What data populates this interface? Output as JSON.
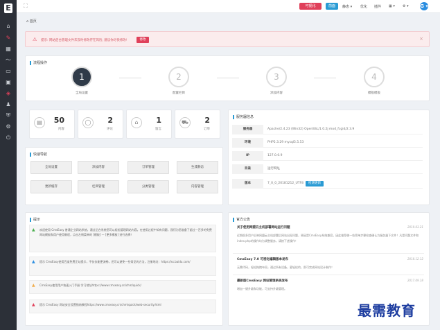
{
  "sidebar": {
    "logo": "E",
    "items": [
      "home-icon",
      "edit-icon",
      "grid-icon",
      "chart-icon",
      "monitor-icon",
      "screen-icon",
      "tag-icon",
      "user-icon",
      "shield-icon",
      "gear-icon",
      "power-icon"
    ]
  },
  "topbar": {
    "red_button": "可视化",
    "blue_button": "前面",
    "menus": [
      "静态 ▾",
      "优化",
      "插件",
      "▦ ▾",
      "⚙ ▾"
    ],
    "avatar": "G ▾"
  },
  "breadcrumb": "首页",
  "alert": {
    "text": "提示: 网站后台管理文件未及时修改存在风险, 建议你尽快修改!",
    "button": "修改",
    "close": "×"
  },
  "flow": {
    "title": "流程操作",
    "steps": [
      {
        "num": "1",
        "label": "全局设置"
      },
      {
        "num": "2",
        "label": "配置栏目"
      },
      {
        "num": "3",
        "label": "添加内容"
      },
      {
        "num": "4",
        "label": "模板模板"
      }
    ]
  },
  "stats": [
    {
      "icon": "document-icon",
      "num": "50",
      "label": "内容"
    },
    {
      "icon": "comment-icon",
      "num": "2",
      "label": "评论"
    },
    {
      "icon": "house-icon",
      "num": "1",
      "label": "留言"
    },
    {
      "icon": "cart-icon",
      "num": "2",
      "label": "订单"
    }
  ],
  "quick": {
    "title": "快速导航",
    "buttons": [
      "全局设置",
      "添加内容",
      "订单管理",
      "生成静态",
      "更新缓存",
      "栏目管理",
      "分类管理",
      "内容管理"
    ]
  },
  "server": {
    "title": "服务器信息",
    "rows": [
      {
        "k": "服务器",
        "v": "Apache/2.4.23 (Win32) OpenSSL/1.0.2j mod_fcgid/2.3.9"
      },
      {
        "k": "环境",
        "v": "PHP5.3.29 mysql5.5.53"
      },
      {
        "k": "IP",
        "v": "127.0.0.9"
      },
      {
        "k": "目录",
        "v": "运行网址"
      },
      {
        "k": "版本",
        "v": "7_0_0_20181212_UTF8",
        "btn": "检测更新"
      }
    ]
  },
  "tips": {
    "title": "提示",
    "items": [
      {
        "color": "#4caf50",
        "text": "欢迎使用 CmsEasy 普通企业网站系统，通过后台系统您可以轻松管理网站内容。在使用过程中如有问题，我们为您准备了超过一百多的免费网站模板和用户使用教程，点击左侧菜单的 [模板] 一 [更多模板] 进行选择！"
      },
      {
        "color": "#2a8de0",
        "text": "提示 CmsEasy使用百度免费正站提示，不仅仅能更流畅，还可以避免一些常见的方法，注册地址：https://ss.baidu.com/"
      },
      {
        "color": "#f0ad4e",
        "text": "CmsEasy使用用户快速入门手册 学习地址https://www.cmseasy.cn/chm/quick/"
      },
      {
        "color": "#e0405a",
        "text": "提示 CmsEasy 网站安全设置指南教程https://www.cmseasy.cn/chm/quick/web-security.html"
      }
    ]
  },
  "announce": {
    "title": "官方公告",
    "items": [
      {
        "title": "关于使用网盟云主机部署网站运行问题",
        "date": "2019.03.21",
        "body": "近期很多用户反映网盟云主机部署后网站出现问题，原因是CmsEasy系统兼容，因此推荐做一些简单步骤检查确认为服务器下文件！凡是问题文件和index.php的操作均为调整服务，请按下述操作！"
      },
      {
        "title": "CmsEasy 7.0 可视化编辑版本发布",
        "date": "2018.12.12",
        "body": "无需代码，轻松拖拽布局，通过所有设备，更轻松的，即可完成网站设计制作！"
      },
      {
        "title": "最新版CmsEasy 网站管理系统发布",
        "date": "2017.09.18",
        "body": "增加一键升级和功能，可支持升级管理。"
      }
    ]
  },
  "watermark": "最需教育"
}
